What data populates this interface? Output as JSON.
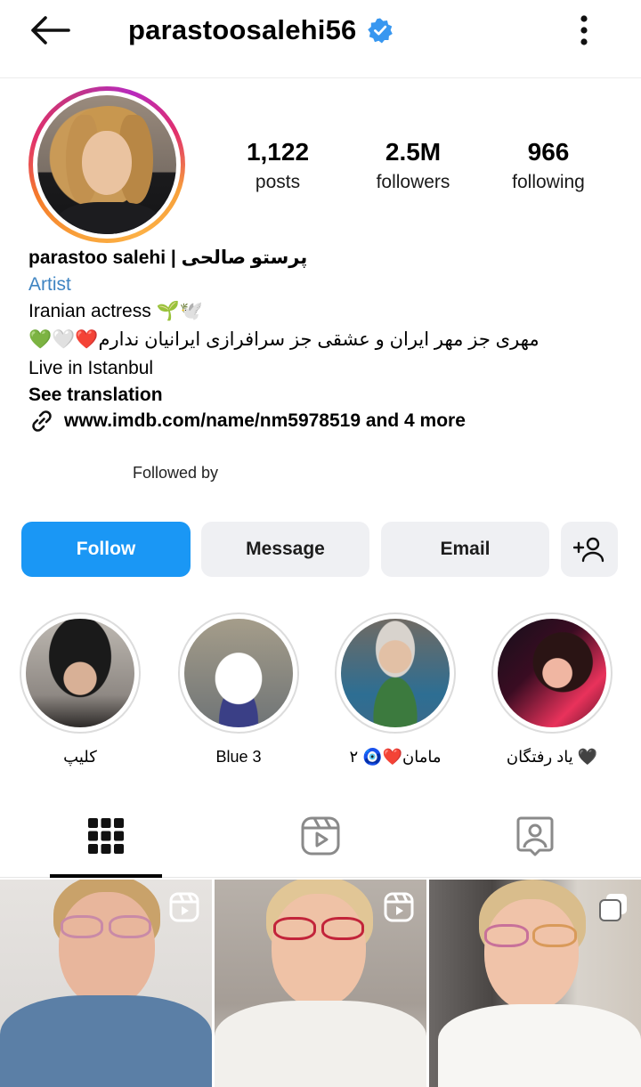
{
  "header": {
    "username": "parastoosalehi56",
    "verified": true,
    "back_icon": "arrow-left-icon",
    "more_icon": "more-vertical-icon"
  },
  "stats": [
    {
      "value": "1,122",
      "label": "posts"
    },
    {
      "value": "2.5M",
      "label": "followers"
    },
    {
      "value": "966",
      "label": "following"
    }
  ],
  "bio": {
    "name": "parastoo salehi | پرستو صالحی",
    "category": "Artist",
    "line1": "Iranian actress 🌱🕊️",
    "line2": "💚🤍❤️مهری جز مهر ایران و عشقی جز سرافرازی ایرانیان ندارم",
    "line3": "Live in Istanbul",
    "see_translation": "See translation",
    "link": "www.imdb.com/name/nm5978519 and 4 more",
    "followed_by": "Followed by"
  },
  "actions": {
    "follow": "Follow",
    "message": "Message",
    "email": "Email",
    "add_user_icon": "add-person-icon"
  },
  "highlights": [
    {
      "label": "کلیپ"
    },
    {
      "label": "Blue 3"
    },
    {
      "label": "مامان❤️🧿 ۲"
    },
    {
      "label": "یاد رفتگان 🖤"
    }
  ],
  "tabs": [
    {
      "icon": "grid-icon",
      "active": true
    },
    {
      "icon": "reels-icon",
      "active": false
    },
    {
      "icon": "tagged-icon",
      "active": false
    }
  ],
  "posts": [
    {
      "type": "reel"
    },
    {
      "type": "reel"
    },
    {
      "type": "carousel"
    }
  ],
  "colors": {
    "accent": "#1a97f5",
    "category": "#3f84c2",
    "verified": "#3897f0",
    "button_bg": "#eff0f3"
  }
}
